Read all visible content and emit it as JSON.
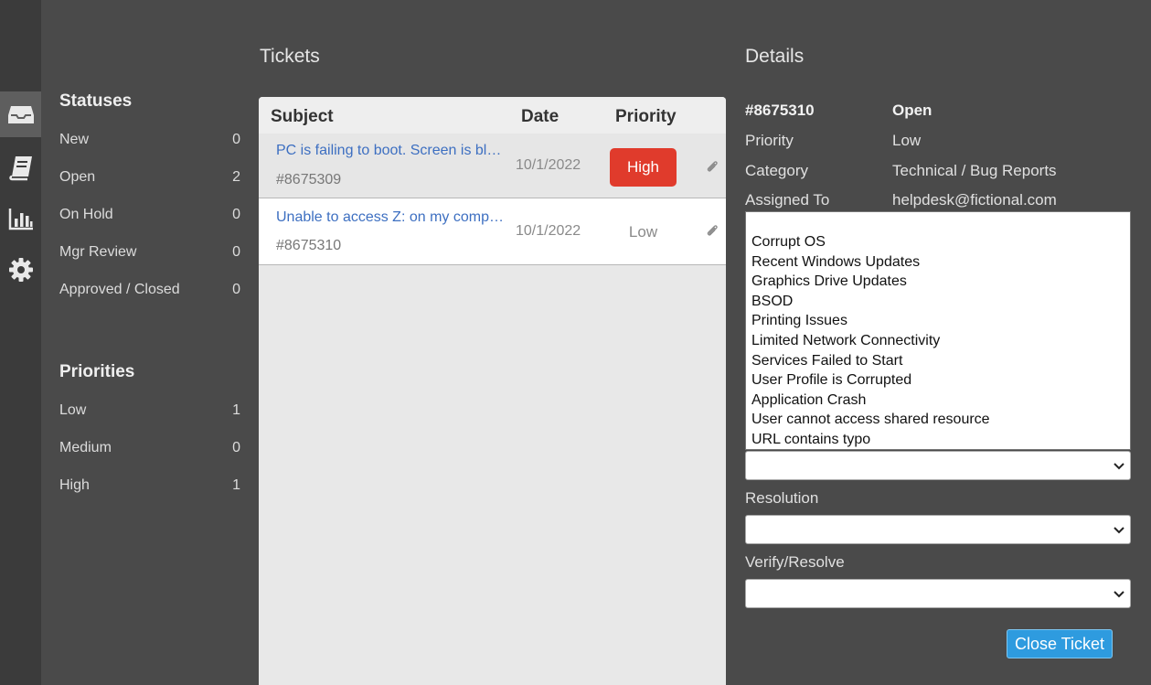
{
  "sidebar": {
    "icons": [
      "inbox-icon",
      "book-icon",
      "bar-chart-icon",
      "gear-icon"
    ]
  },
  "filters": {
    "statuses_title": "Statuses",
    "statuses": [
      {
        "label": "New",
        "count": "0"
      },
      {
        "label": "Open",
        "count": "2"
      },
      {
        "label": "On Hold",
        "count": "0"
      },
      {
        "label": "Mgr Review",
        "count": "0"
      },
      {
        "label": "Approved / Closed",
        "count": "0"
      }
    ],
    "priorities_title": "Priorities",
    "priorities": [
      {
        "label": "Low",
        "count": "1"
      },
      {
        "label": "Medium",
        "count": "0"
      },
      {
        "label": "High",
        "count": "1"
      }
    ]
  },
  "tickets": {
    "title": "Tickets",
    "columns": {
      "subject": "Subject",
      "date": "Date",
      "priority": "Priority"
    },
    "rows": [
      {
        "subject": "PC is failing to boot. Screen is black",
        "id": "#8675309",
        "date": "10/1/2022",
        "priority": "High",
        "priority_color": "#e03b2c"
      },
      {
        "subject": "Unable to access Z: on my computer",
        "id": "#8675310",
        "date": "10/1/2022",
        "priority": "Low"
      }
    ]
  },
  "details": {
    "title": "Details",
    "ticket_id": "#8675310",
    "status": "Open",
    "priority_label": "Priority",
    "priority_value": "Low",
    "category_label": "Category",
    "category_value": "Technical / Bug Reports",
    "assigned_label": "Assigned To",
    "assigned_value": "helpdesk@fictional.com",
    "issue_options": [
      "Corrupt OS",
      "Recent Windows Updates",
      "Graphics Drive Updates",
      "BSOD",
      "Printing Issues",
      "Limited Network Connectivity",
      "Services Failed to Start",
      "User Profile is Corrupted",
      "Application Crash",
      "User cannot access shared resource",
      "URL contains typo"
    ],
    "issue_select_value": "",
    "resolution_label": "Resolution",
    "resolution_value": "",
    "verify_label": "Verify/Resolve",
    "verify_value": "",
    "close_button": "Close Ticket",
    "accent_color": "#2e9bdf"
  }
}
